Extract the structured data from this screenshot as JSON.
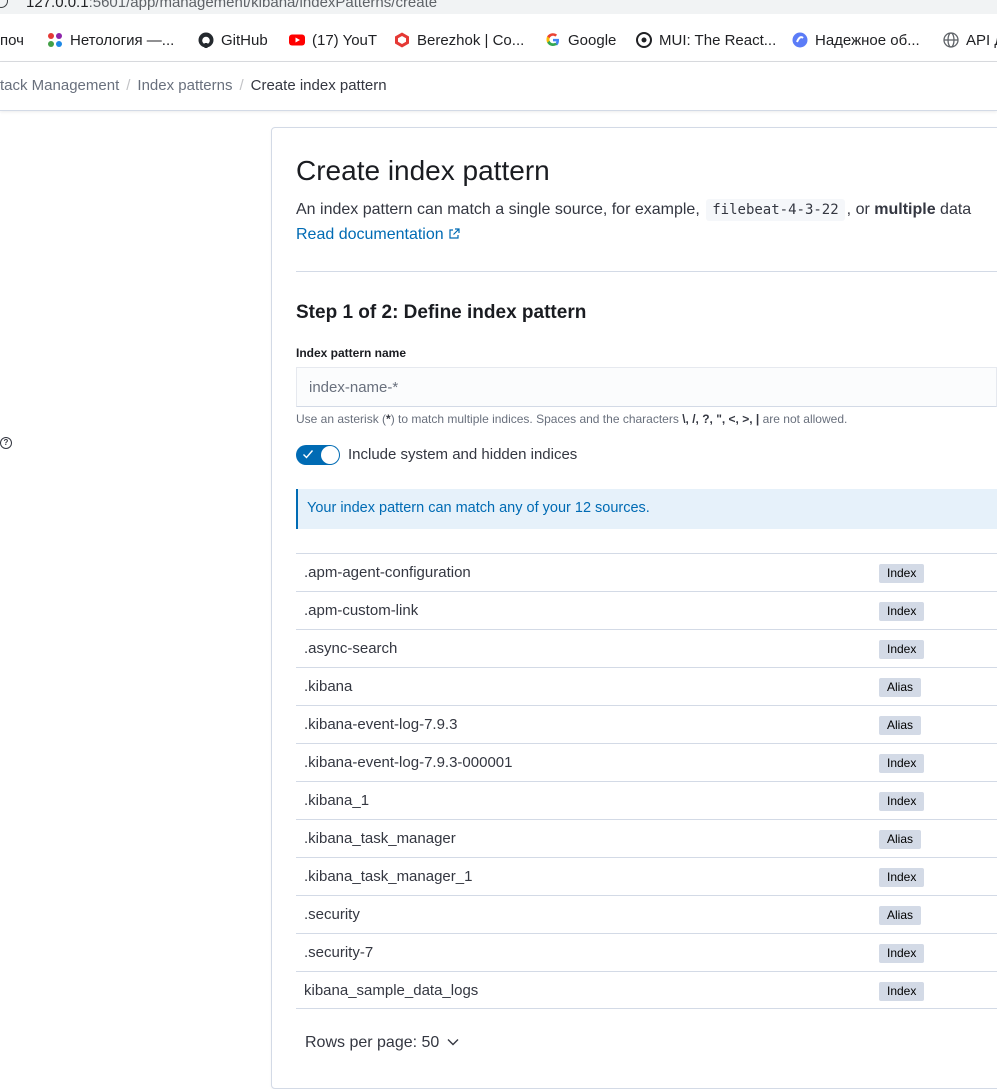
{
  "browser": {
    "url_host": "127.0.0.1",
    "url_rest": ":5601/app/management/kibana/indexPatterns/create",
    "bookmarks": [
      {
        "label": "поч",
        "icon": "none"
      },
      {
        "label": "Нетология —...",
        "icon": "netology-icon"
      },
      {
        "label": "GitHub",
        "icon": "github-icon"
      },
      {
        "label": "(17) YouT",
        "icon": "youtube-icon"
      },
      {
        "label": "Berezhok | Co...",
        "icon": "berezhok-icon"
      },
      {
        "label": "Google",
        "icon": "google-icon"
      },
      {
        "label": "MUI: The React...",
        "icon": "mui-icon"
      },
      {
        "label": "Надежное об...",
        "icon": "shield-globe-icon"
      },
      {
        "label": "API д",
        "icon": "globe-icon"
      }
    ]
  },
  "breadcrumbs": {
    "stack": "tack Management",
    "index_patterns": "Index patterns",
    "current": "Create index pattern"
  },
  "page": {
    "title": "Create index pattern",
    "desc_prefix": "An index pattern can match a single source, for example,",
    "desc_code": "filebeat-4-3-22",
    "desc_middle": ", or",
    "desc_bold": "multiple",
    "desc_suffix": "data",
    "doc_link": "Read documentation"
  },
  "step": {
    "title": "Step 1 of 2: Define index pattern",
    "field_label": "Index pattern name",
    "placeholder": "index-name-*",
    "help_prefix": "Use an asterisk (",
    "help_star": "*",
    "help_mid": ") to match multiple indices. Spaces and the characters",
    "help_chars": "\\, /, ?, \", <, >, |",
    "help_suffix": "are not allowed.",
    "toggle_label": "Include system and hidden indices",
    "toggle_on": true,
    "callout": "Your index pattern can match any of your 12 sources."
  },
  "sources": [
    {
      "name": ".apm-agent-configuration",
      "type": "Index"
    },
    {
      "name": ".apm-custom-link",
      "type": "Index"
    },
    {
      "name": ".async-search",
      "type": "Index"
    },
    {
      "name": ".kibana",
      "type": "Alias"
    },
    {
      "name": ".kibana-event-log-7.9.3",
      "type": "Alias"
    },
    {
      "name": ".kibana-event-log-7.9.3-000001",
      "type": "Index"
    },
    {
      "name": ".kibana_1",
      "type": "Index"
    },
    {
      "name": ".kibana_task_manager",
      "type": "Alias"
    },
    {
      "name": ".kibana_task_manager_1",
      "type": "Index"
    },
    {
      "name": ".security",
      "type": "Alias"
    },
    {
      "name": ".security-7",
      "type": "Index"
    },
    {
      "name": "kibana_sample_data_logs",
      "type": "Index"
    }
  ],
  "pagination": {
    "rows_per_page": "Rows per page: 50"
  },
  "colors": {
    "accent": "#006bb4",
    "callout_bg": "#e6f1fa",
    "badge_bg": "#d3dae6"
  }
}
